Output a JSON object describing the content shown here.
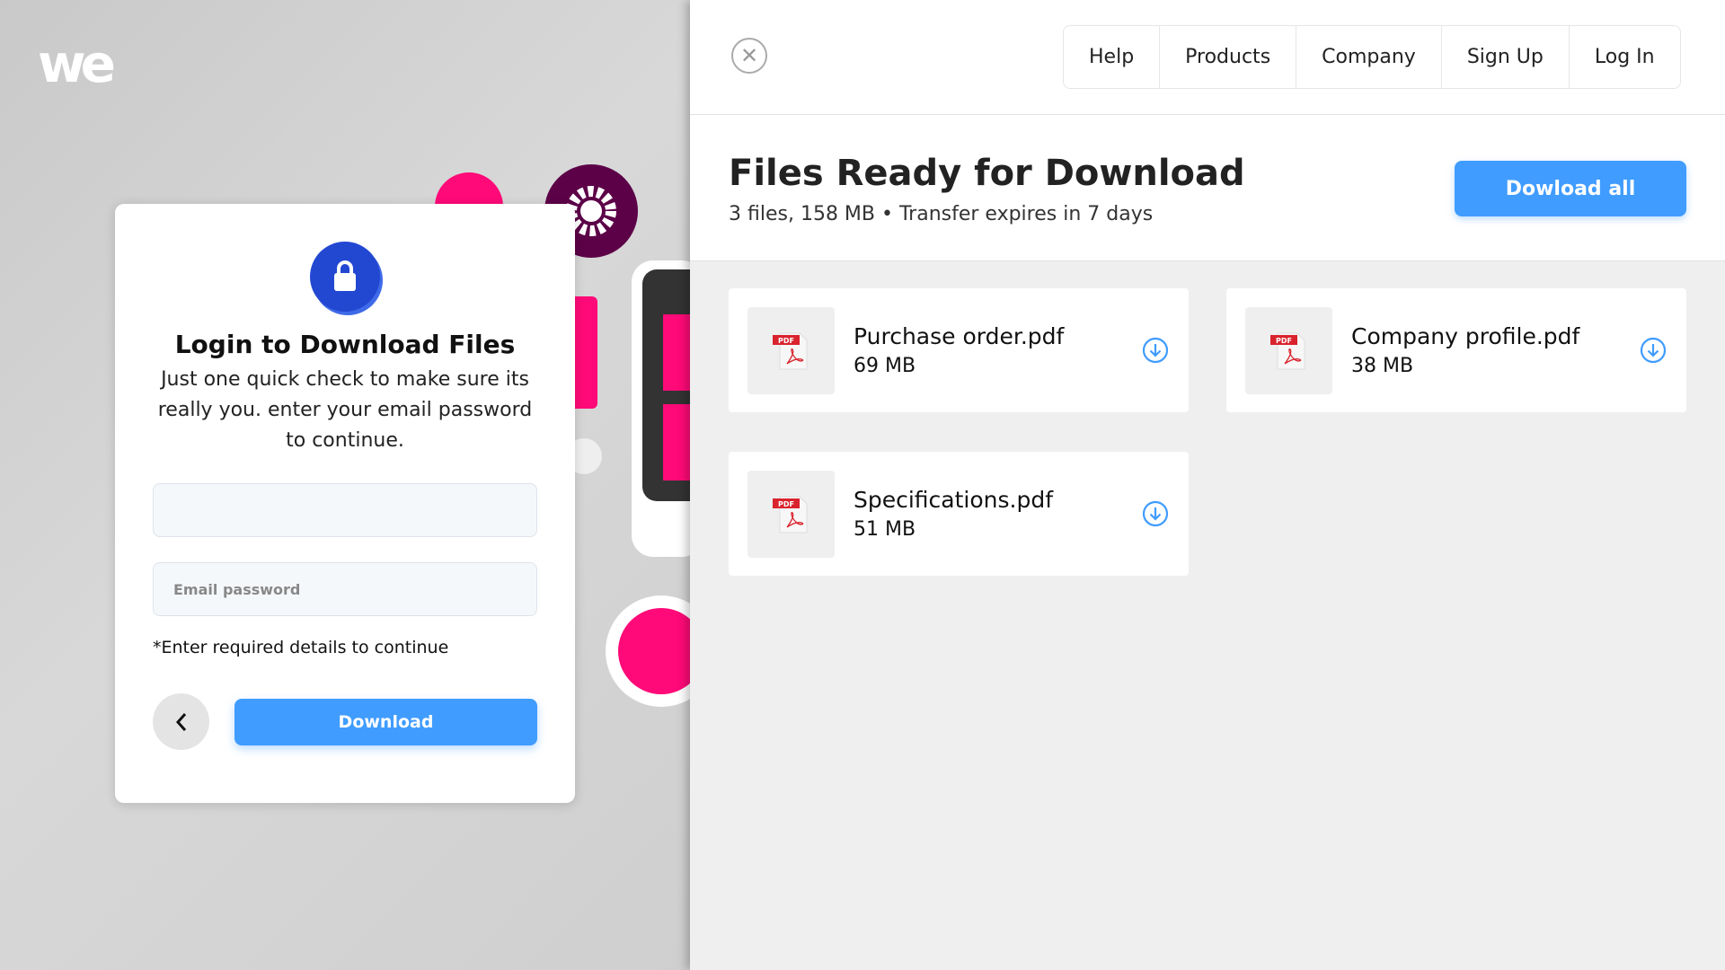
{
  "brand": {
    "logo_text": "we"
  },
  "modal": {
    "title": "Login to Download Files",
    "description": "Just one quick check to make sure its really you. enter your email password to continue.",
    "email_value": "",
    "password_placeholder": "Email password",
    "note": "*Enter required details to continue",
    "download_label": "Download"
  },
  "nav": {
    "items": [
      "Help",
      "Products",
      "Company",
      "Sign Up",
      "Log In"
    ]
  },
  "transfer": {
    "title": "Files Ready for Download",
    "meta": "3 files, 158 MB • Transfer expires in 7 days",
    "download_all_label": "Dowload all",
    "files": [
      {
        "name": "Purchase order.pdf",
        "size": "69 MB",
        "badge": "PDF"
      },
      {
        "name": "Company profile.pdf",
        "size": "38 MB",
        "badge": "PDF"
      },
      {
        "name": "Specifications.pdf",
        "size": "51 MB",
        "badge": "PDF"
      }
    ]
  },
  "colors": {
    "accent": "#409cff",
    "lock": "#2248d2",
    "pink": "#ff0a78",
    "purple": "#5c0048"
  }
}
